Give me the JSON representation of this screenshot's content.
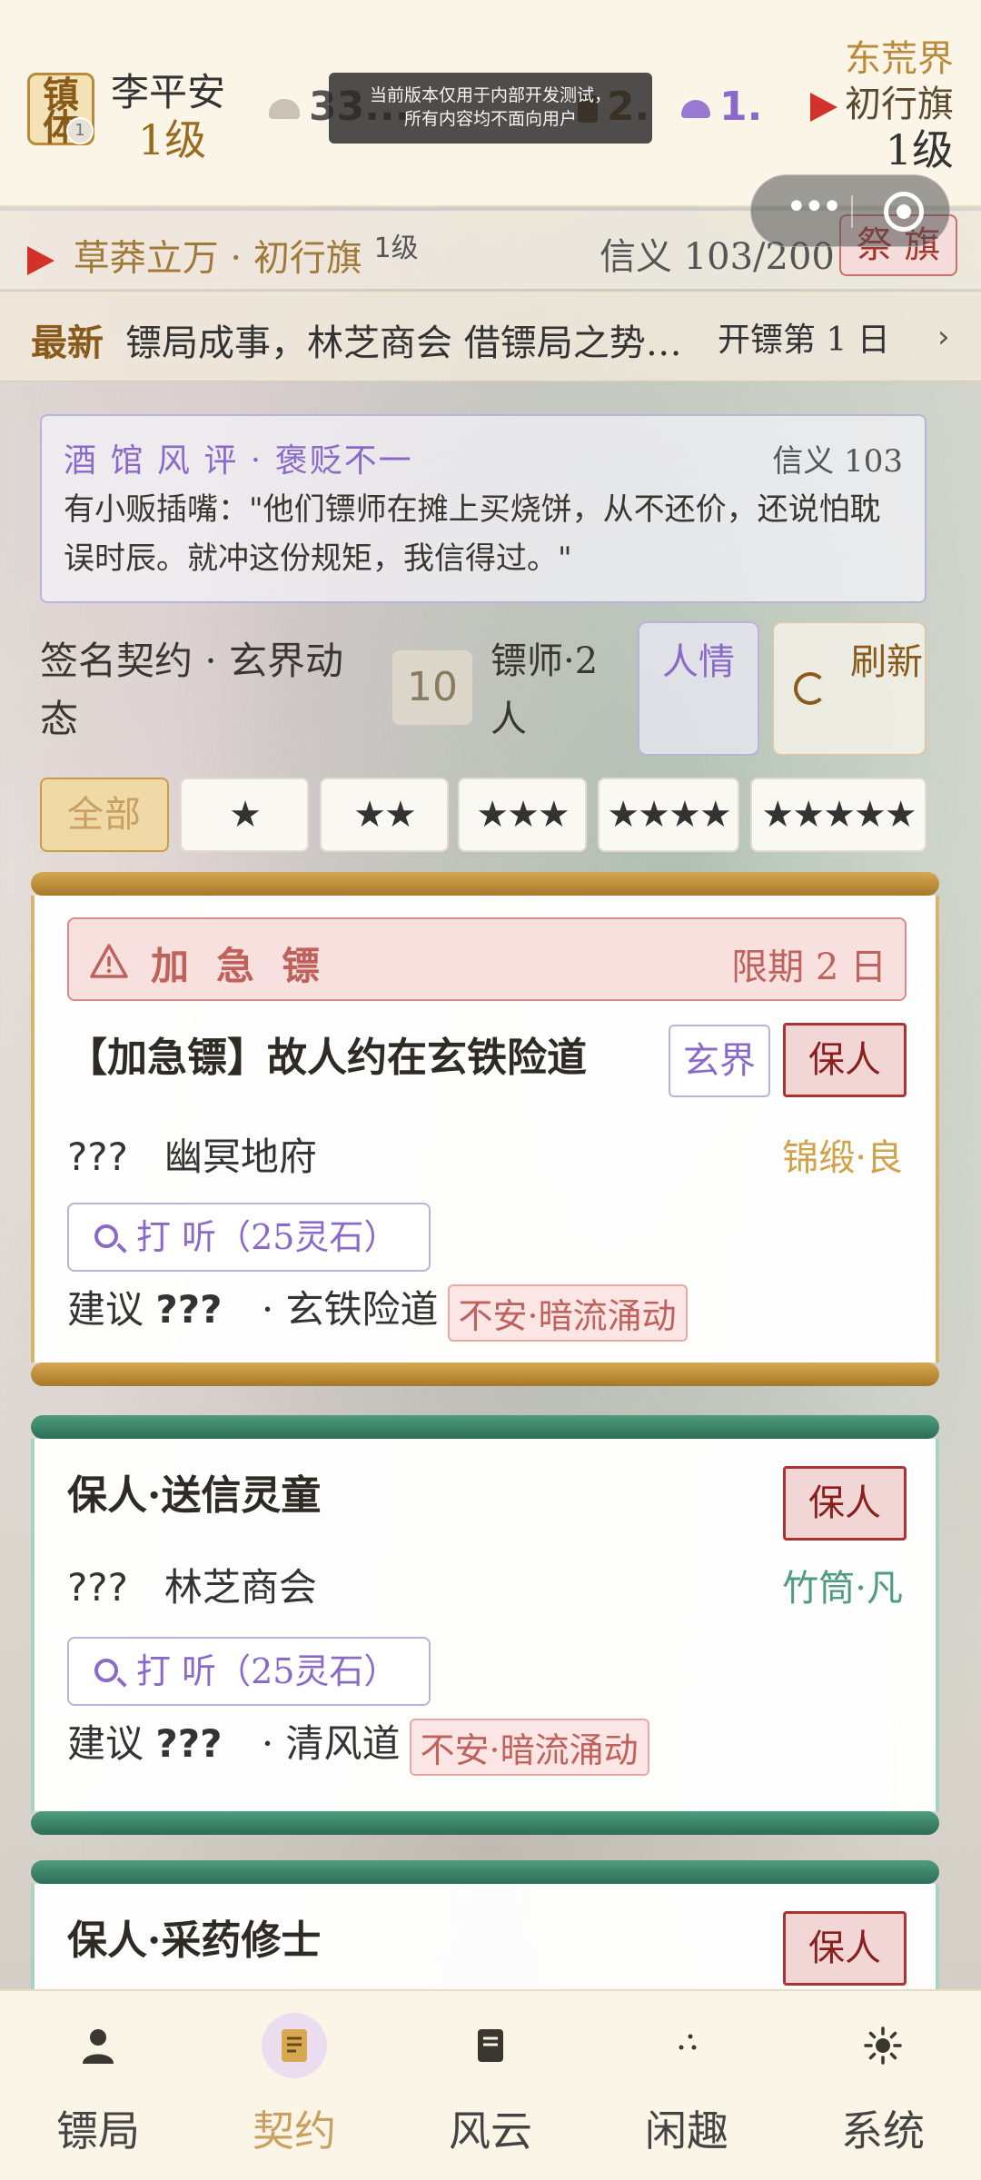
{
  "header": {
    "seal_text": "镇体",
    "seal_badge": "1",
    "player_name": "李平安",
    "player_level": "1级",
    "resources": [
      {
        "icon": "hat-icon",
        "value": "33..."
      },
      {
        "icon": "jar-icon",
        "value": "2."
      },
      {
        "icon": "cloud-icon",
        "value": "1."
      }
    ],
    "dev_notice_line1": "当前版本仅用于内部开发测试，",
    "dev_notice_line2": "所有内容均不面向用户",
    "realm_name": "东荒界",
    "realm_flag": "初行旗",
    "realm_level": "1级"
  },
  "guild": {
    "name": "草莽立万 · 初行旗",
    "level": "1级",
    "xinyi": "信义 103/200",
    "ji_button": "祭 旗"
  },
  "news": {
    "tag": "最新",
    "text": "镖局成事，林芝商会 借镖局之势…",
    "day": "开镖第 1 日",
    "arrow": "›"
  },
  "review": {
    "title": "酒 馆 风 评 · 褒贬不一",
    "xinyi": "信义 103",
    "body": "有小贩插嘴：\"他们镖师在摊上买烧饼，从不还价，还说怕耽误时辰。就冲这份规矩，我信得过。\""
  },
  "contract": {
    "label": "签名契约 · 玄界动态",
    "count": "10",
    "staff": "镖师·2人",
    "renqing_button": "人情",
    "refresh_button": "刷新"
  },
  "filters": [
    "全部",
    "★",
    "★★",
    "★★★",
    "★★★★",
    "★★★★★"
  ],
  "cards": [
    {
      "urgent_label": "加急镖",
      "urgent_limit": "限期 2 日",
      "title": "【加急镖】故人约在玄铁险道",
      "realm_tag": "玄界",
      "action": "保人",
      "unknown": "???",
      "client": "幽冥地府",
      "goods": "锦缎·良",
      "inquire": "打 听（25灵石）",
      "advice_prefix": "建议",
      "advice_value": "???",
      "route": "· 玄铁险道",
      "risk": "不安·暗流涌动"
    },
    {
      "title": "保人·送信灵童",
      "action": "保人",
      "unknown": "???",
      "client": "林芝商会",
      "goods": "竹筒·凡",
      "inquire": "打 听（25灵石）",
      "advice_prefix": "建议",
      "advice_value": "???",
      "route": "· 清风道",
      "risk": "不安·暗流涌动"
    },
    {
      "title": "保人·采药修士",
      "action": "保人"
    }
  ],
  "nav": [
    {
      "icon": "person-icon",
      "label": "镖局"
    },
    {
      "icon": "scroll-icon",
      "label": "契约",
      "active": true
    },
    {
      "icon": "book-icon",
      "label": "风云"
    },
    {
      "icon": "sparkle-icon",
      "label": "闲趣"
    },
    {
      "icon": "sun-icon",
      "label": "系统"
    }
  ],
  "colors": {
    "gold": "#c9a060",
    "red": "#a8342e",
    "purple": "#8a6ac8",
    "green": "#2c6e56"
  }
}
